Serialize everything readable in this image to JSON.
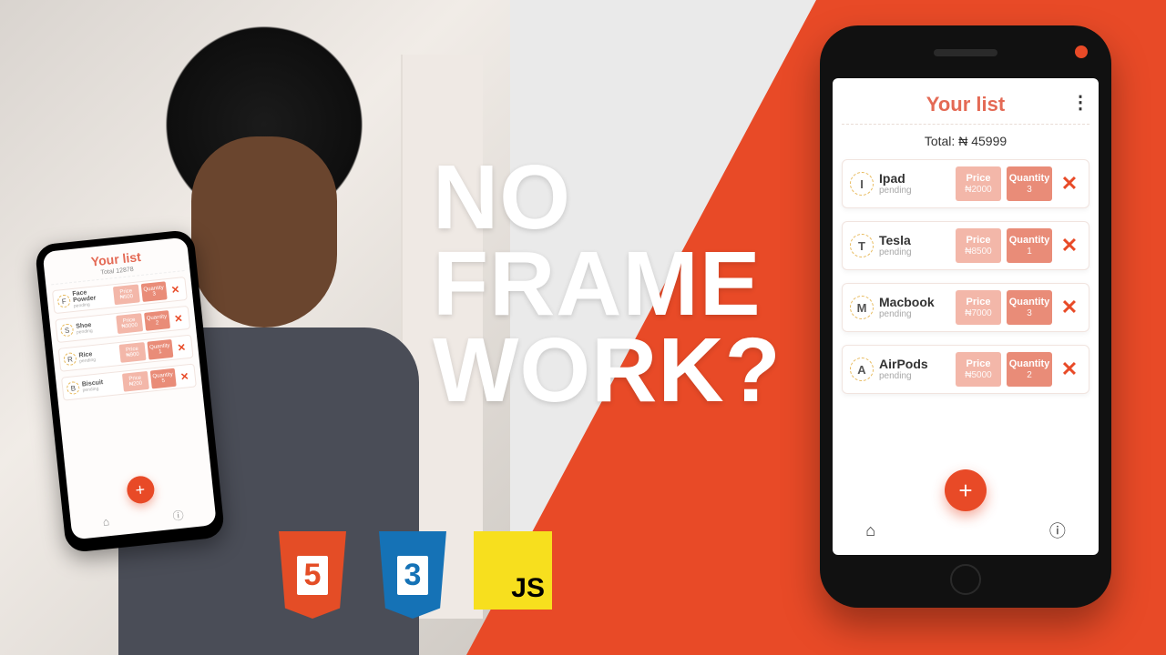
{
  "headline": {
    "line1": "NO",
    "line2": "FRAME",
    "line3": "WORK?"
  },
  "badges": {
    "html": "5",
    "css": "3",
    "js": "JS"
  },
  "small_phone": {
    "title": "Your list",
    "total_label": "Total",
    "total_value": "12878",
    "items": [
      {
        "initial": "F",
        "name": "Face Powder",
        "status": "pending",
        "price_label": "Price",
        "price": "₦500",
        "qty_label": "Quantity",
        "qty": "3"
      },
      {
        "initial": "S",
        "name": "Shoe",
        "status": "pending",
        "price_label": "Price",
        "price": "₦3000",
        "qty_label": "Quantity",
        "qty": "2"
      },
      {
        "initial": "R",
        "name": "Rice",
        "status": "pending",
        "price_label": "Price",
        "price": "₦900",
        "qty_label": "Quantity",
        "qty": "1"
      },
      {
        "initial": "B",
        "name": "Biscuit",
        "status": "pending",
        "price_label": "Price",
        "price": "₦200",
        "qty_label": "Quantity",
        "qty": "5"
      }
    ],
    "fab": "+",
    "nav": {
      "home": "⌂",
      "info": "ⓘ"
    }
  },
  "big_phone": {
    "title": "Your list",
    "menu": "⋮",
    "total_label": "Total:",
    "currency": "₦",
    "total_value": "45999",
    "price_label": "Price",
    "qty_label": "Quantity",
    "items": [
      {
        "initial": "I",
        "name": "Ipad",
        "status": "pending",
        "price": "₦2000",
        "qty": "3"
      },
      {
        "initial": "T",
        "name": "Tesla",
        "status": "pending",
        "price": "₦8500",
        "qty": "1"
      },
      {
        "initial": "M",
        "name": "Macbook",
        "status": "pending",
        "price": "₦7000",
        "qty": "3"
      },
      {
        "initial": "A",
        "name": "AirPods",
        "status": "pending",
        "price": "₦5000",
        "qty": "2"
      }
    ],
    "fab": "+",
    "nav": {
      "home": "⌂",
      "info": "ⓘ"
    }
  }
}
